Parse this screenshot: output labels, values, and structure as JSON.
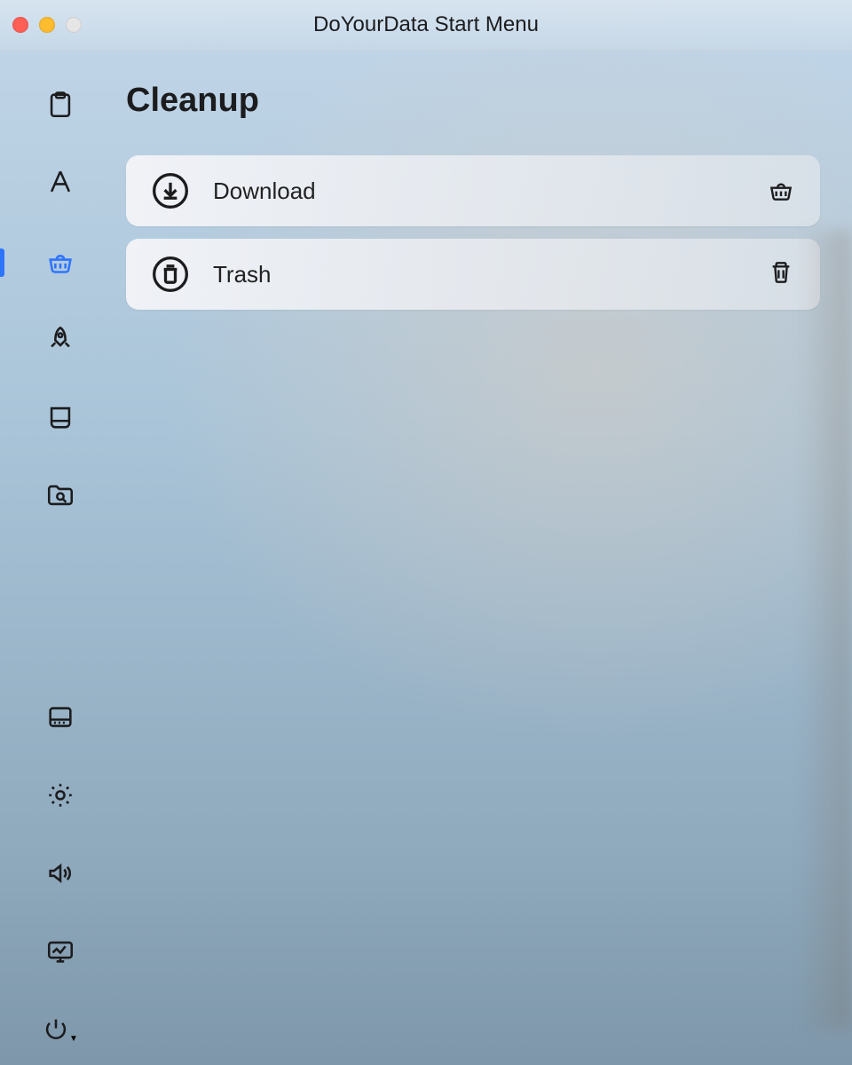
{
  "window": {
    "title": "DoYourData Start Menu"
  },
  "sidebar": {
    "items": [
      {
        "name": "clipboard",
        "icon": "clipboard-icon",
        "active": false
      },
      {
        "name": "apps",
        "icon": "apps-icon",
        "active": false
      },
      {
        "name": "cleanup",
        "icon": "basket-icon",
        "active": true
      },
      {
        "name": "rocket",
        "icon": "rocket-icon",
        "active": false
      },
      {
        "name": "drive",
        "icon": "drive-icon",
        "active": false
      },
      {
        "name": "search-folder",
        "icon": "folder-search-icon",
        "active": false
      }
    ],
    "bottom_items": [
      {
        "name": "dock",
        "icon": "dock-icon"
      },
      {
        "name": "brightness",
        "icon": "sun-icon"
      },
      {
        "name": "sound",
        "icon": "speaker-icon"
      },
      {
        "name": "desktop",
        "icon": "desktop-icon"
      },
      {
        "name": "power",
        "icon": "power-icon"
      }
    ]
  },
  "page": {
    "title": "Cleanup",
    "items": [
      {
        "icon": "download-icon",
        "label": "Download",
        "action_icon": "basket-icon",
        "key": "download"
      },
      {
        "icon": "trash-circle-icon",
        "label": "Trash",
        "action_icon": "trash-icon",
        "key": "trash"
      }
    ]
  },
  "colors": {
    "accent": "#2f74ff"
  }
}
